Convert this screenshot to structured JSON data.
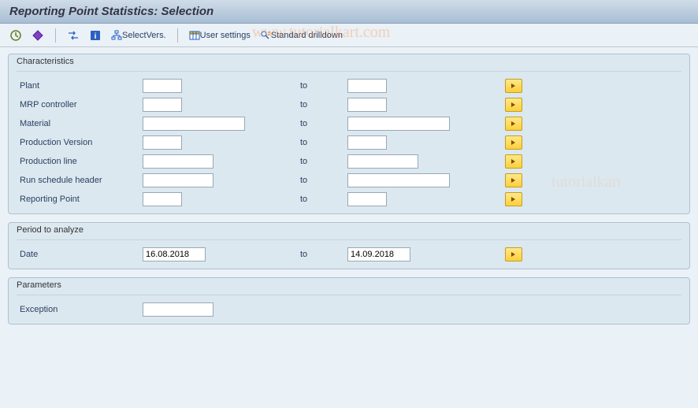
{
  "page": {
    "title": "Reporting Point Statistics: Selection"
  },
  "toolbar": {
    "select_vers": "SelectVers.",
    "user_settings": "User settings",
    "standard_drilldown": "Standard drilldown"
  },
  "to_label": "to",
  "groups": {
    "characteristics": {
      "title": "Characteristics",
      "rows": {
        "plant": {
          "label": "Plant",
          "from": "",
          "to": ""
        },
        "mrp_controller": {
          "label": "MRP controller",
          "from": "",
          "to": ""
        },
        "material": {
          "label": "Material",
          "from": "",
          "to": ""
        },
        "production_version": {
          "label": "Production Version",
          "from": "",
          "to": ""
        },
        "production_line": {
          "label": "Production line",
          "from": "",
          "to": ""
        },
        "run_schedule_header": {
          "label": "Run schedule header",
          "from": "",
          "to": ""
        },
        "reporting_point": {
          "label": "Reporting Point",
          "from": "",
          "to": ""
        }
      }
    },
    "period": {
      "title": "Period to analyze",
      "date": {
        "label": "Date",
        "from": "16.08.2018",
        "to": "14.09.2018"
      }
    },
    "parameters": {
      "title": "Parameters",
      "exception": {
        "label": "Exception",
        "value": ""
      }
    }
  },
  "watermark": "www.tutorialkart.com"
}
